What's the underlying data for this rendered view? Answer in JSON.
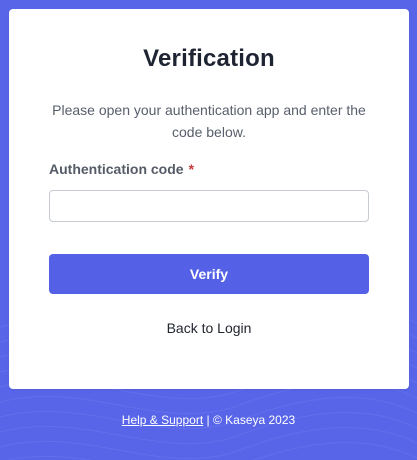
{
  "colors": {
    "background": "#5865e8",
    "accent": "#5461e6",
    "required": "#c43b3b"
  },
  "card": {
    "title": "Verification",
    "description": "Please open your authentication app and enter the code below.",
    "field": {
      "label": "Authentication code",
      "required_marker": "*",
      "value": "",
      "placeholder": ""
    },
    "verify_label": "Verify",
    "back_label": "Back to Login"
  },
  "footer": {
    "help_link": "Help & Support",
    "separator": " | ",
    "copyright": "© Kaseya 2023"
  }
}
